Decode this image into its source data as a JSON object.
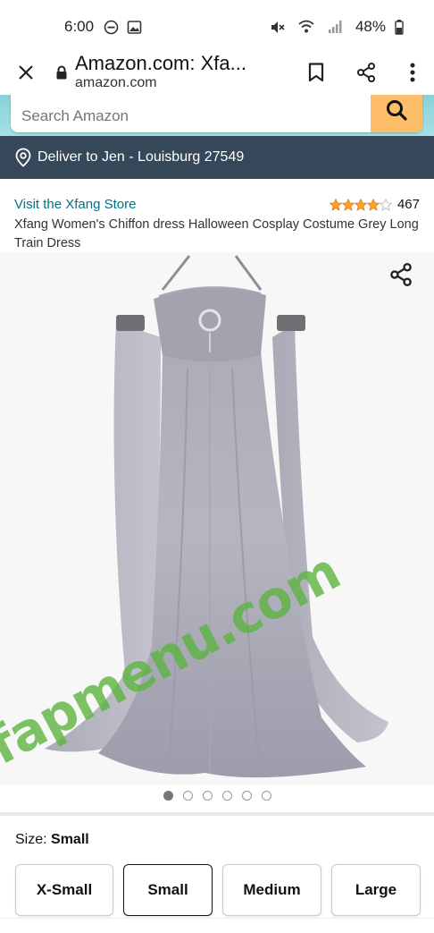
{
  "status_bar": {
    "time": "6:00",
    "battery": "48%",
    "icons": [
      "do-not-disturb-icon",
      "gallery-icon",
      "mute-icon",
      "wifi-icon",
      "signal-icon",
      "battery-icon"
    ]
  },
  "browser": {
    "page_title": "Amazon.com: Xfa...",
    "domain": "amazon.com",
    "icons": [
      "close-icon",
      "lock-icon",
      "bookmark-icon",
      "share-icon",
      "more-vertical-icon"
    ]
  },
  "search": {
    "placeholder": "Search Amazon",
    "icon": "search-icon"
  },
  "deliver": {
    "text": "Deliver to Jen - Louisburg 27549",
    "icon": "location-pin-icon"
  },
  "product": {
    "store_link": "Visit the Xfang Store",
    "rating": 4,
    "rating_max": 5,
    "review_count": "467",
    "title": "Xfang Women's Chiffon dress Halloween Cosplay Costume Grey Long Train Dress",
    "image_alt": "grey chiffon long train dress",
    "share_icon": "share-icon"
  },
  "carousel": {
    "total": 6,
    "active_index": 0
  },
  "size": {
    "label": "Size:",
    "selected": "Small",
    "options": [
      "X-Small",
      "Small",
      "Medium",
      "Large"
    ]
  },
  "watermark": "fapmenu.com",
  "colors": {
    "deliver_bar": "#37475a",
    "search_button": "#febd69",
    "link": "#007185",
    "star": "#ffa41c"
  }
}
